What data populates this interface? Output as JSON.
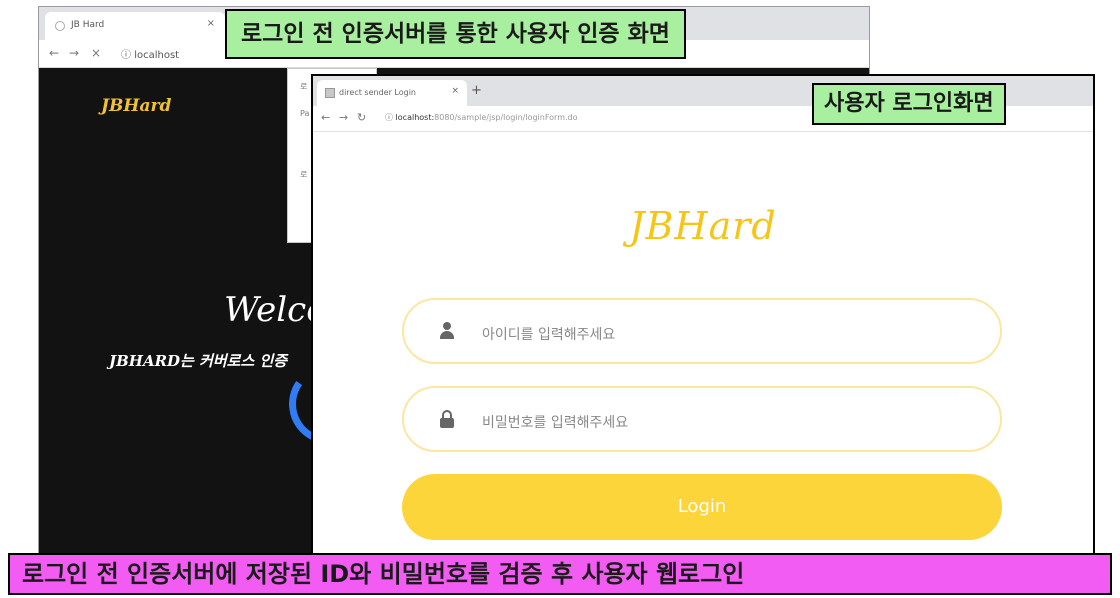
{
  "back_window": {
    "tab_title": "JB Hard",
    "url": "localhost",
    "logo": "JBHard",
    "welcome": "Welco",
    "subtext": "JBHARD는 커버로스 인증"
  },
  "front_window": {
    "tab_title": "direct sender Login",
    "url_host": "localhost:",
    "url_path": "8080/sample/jsp/login/loginForm.do",
    "logo": "JBHard",
    "id_placeholder": "아이디를 입력해주세요",
    "pw_placeholder": "비밀번호를 입력해주세요",
    "login_label": "Login"
  },
  "captions": {
    "top": "로그인 전 인증서버를 통한 사용자 인증 화면",
    "right": "사용자 로그인화면",
    "bottom": "로그인 전 인증서버에 저장된 ID와 비밀번호를 검증 후 사용자 웹로그인"
  },
  "colors": {
    "brand_yellow": "#fcd53b",
    "caption_green": "#a8f0a0",
    "caption_magenta": "#f35cf3",
    "dark_bg": "#121212",
    "accent_blue": "#2f7cf5"
  }
}
